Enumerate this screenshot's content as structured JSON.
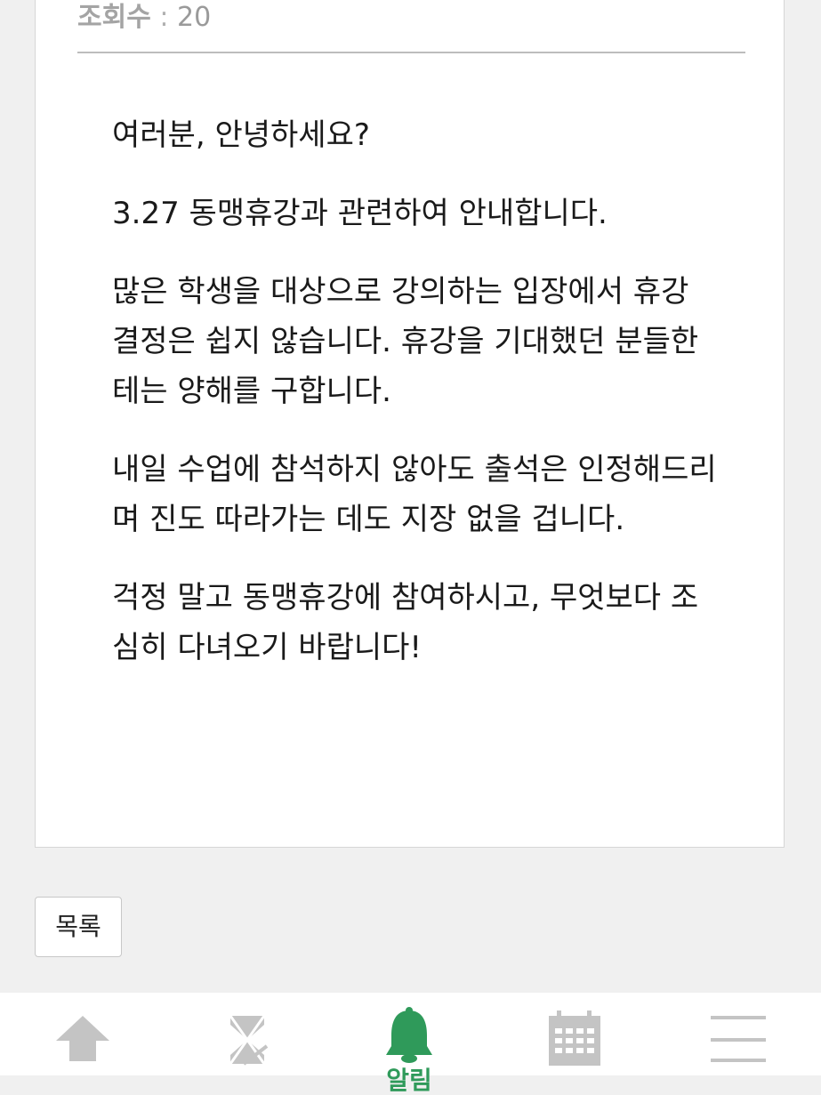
{
  "post": {
    "views_label": "조회수",
    "views_separator": ":",
    "views_count": "20",
    "paragraphs": [
      "여러분, 안녕하세요?",
      "3.27 동맹휴강과 관련하여 안내합니다.",
      "많은 학생을 대상으로 강의하는 입장에서 휴강 결정은 쉽지 않습니다. 휴강을 기대했던 분들한테는 양해를 구합니다.",
      "내일 수업에 참석하지 않아도 출석은 인정해드리며 진도 따라가는 데도 지장 없을 겁니다.",
      "걱정 말고 동맹휴강에 참여하시고, 무엇보다 조심히 다녀오기 바랍니다!"
    ]
  },
  "actions": {
    "list_label": "목록"
  },
  "bottom_nav": {
    "items": [
      {
        "icon": "home-icon",
        "active": false
      },
      {
        "icon": "hourglass-icon",
        "active": false
      },
      {
        "icon": "bell-icon",
        "active": true,
        "label": "알림"
      },
      {
        "icon": "calendar-icon",
        "active": false
      },
      {
        "icon": "menu-icon",
        "active": false
      }
    ]
  },
  "colors": {
    "accent": "#2f9a5a",
    "icon_inactive": "#c4c4c4",
    "background": "#f0f0f0"
  }
}
